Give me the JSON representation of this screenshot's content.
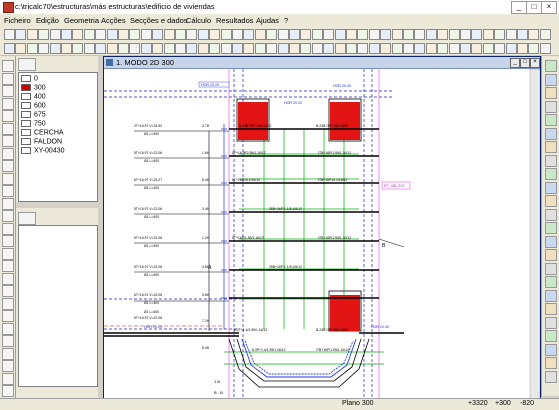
{
  "window": {
    "title": "c:\\tricalc70\\estructuras\\más estructuras\\edificio de viviendas"
  },
  "menu": [
    "Ficheiro",
    "Edição",
    "Geometria",
    "Acções",
    "Secções e dados",
    "Cálculo",
    "Resultados",
    "Ajudas",
    "?"
  ],
  "layers": [
    "0",
    "300",
    "400",
    "600",
    "675",
    "750",
    "CERCHA",
    "FALDON",
    "XY-00430"
  ],
  "drawing": {
    "title": "1. MODO 2D 300",
    "labels": {
      "hor_top_left": "HOR 20.20",
      "hor_top_mid": "HOR 20.20",
      "hor_top_right": "HOR 20.20",
      "hor_bottom_left": "HOR 20.20",
      "hor_bottom_right": "HOR 20.20",
      "pink_tag": "PF_XBL 2V2"
    },
    "beam_rows": [
      {
        "code": "3.7H",
        "left": "2T+16.97 V=24.92",
        "left2": "Ø1 L=400",
        "mid": "B.23B+3P+100.16/12",
        "right": "B.23B+3P+100.16/12"
      },
      {
        "code": "1.6H",
        "left": "5T+16.97 V=22.06",
        "left2": "Ø1 L=400",
        "mid": "8F+16.9P2.95/1.16/12",
        "right": "ITB+16P/1.95/1.16/12"
      },
      {
        "code": "5.4H",
        "left": "6T+16.97 V=23.27",
        "left2": "Ø1 L=400",
        "mid": "8T+16P15.1/16/12",
        "right": "ITB+16P15.1/16/12"
      },
      {
        "code": "3.4H",
        "left": "5T+16.97 V=22.06",
        "left2": "Ø1 L=400",
        "mid": "25B+16P 1.1/5.1/6/12",
        "right": ""
      },
      {
        "code": "1.2H",
        "left": "5T+16.97 V=22.06",
        "left2": "Ø1 L=400",
        "mid": "8T+16P/1.95/1.16/12",
        "right": "ITB+16P/1.95/1.16/12"
      },
      {
        "code": "4.8H",
        "left": "5T+16.97 V=22.06",
        "left2": "Ø1 L=400",
        "mid": "25B+16P 1.1/5.1/6/12",
        "right": ""
      },
      {
        "code": "5.8H",
        "left": "6T+16.97 V=22.06",
        "left2": "Ø1 L=400",
        "mid": "",
        "right": ""
      },
      {
        "code": "7.2H",
        "left": "5T+16.97 V=22.06",
        "left2": "Ø1 L=400",
        "mid": "8.2T+1.4/1.96/1.16/12",
        "right": "B.23B+3P+100.16/12"
      },
      {
        "code": "9.4H",
        "left": "",
        "left2": "",
        "mid": "8.3P+1.4/1.95/1.16/12",
        "right": "ITB+16P/1.95/1.16/12"
      }
    ],
    "left_marker": "A",
    "right_marker": "B",
    "bottom_marker": "B - B",
    "bottom_note": "1.B"
  },
  "status": {
    "plane": "Plano 300",
    "coord1": "+3320",
    "coord2": "+300",
    "coord3": "-820"
  }
}
